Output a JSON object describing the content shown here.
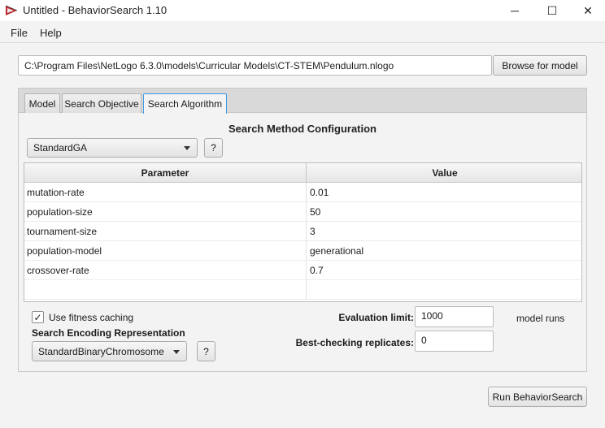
{
  "window": {
    "title": "Untitled - BehaviorSearch 1.10",
    "app_icon": "behaviorsearch-logo-icon",
    "controls": {
      "minimize": "─",
      "maximize": "☐",
      "close": "✕"
    }
  },
  "menu": {
    "items": [
      {
        "label": "File"
      },
      {
        "label": "Help"
      }
    ]
  },
  "model_path": {
    "value": "C:\\Program Files\\NetLogo 6.3.0\\models\\Curricular Models\\CT-STEM\\Pendulum.nlogo",
    "browse_label": "Browse for model"
  },
  "tabs": [
    {
      "label": "Model",
      "active": false
    },
    {
      "label": "Search Objective",
      "active": false
    },
    {
      "label": "Search Algorithm",
      "active": true
    }
  ],
  "search_method": {
    "title": "Search Method Configuration",
    "selected": "StandardGA",
    "help_label": "?"
  },
  "params_table": {
    "headers": {
      "parameter": "Parameter",
      "value": "Value"
    },
    "rows": [
      {
        "parameter": "mutation-rate",
        "value": "0.01"
      },
      {
        "parameter": "population-size",
        "value": "50"
      },
      {
        "parameter": "tournament-size",
        "value": "3"
      },
      {
        "parameter": "population-model",
        "value": "generational"
      },
      {
        "parameter": "crossover-rate",
        "value": "0.7"
      }
    ]
  },
  "fitness_caching": {
    "label": "Use fitness caching",
    "checked": true,
    "check_glyph": "✓"
  },
  "encoding": {
    "title": "Search Encoding Representation",
    "selected": "StandardBinaryChromosome",
    "help_label": "?"
  },
  "evaluation": {
    "limit_label": "Evaluation limit:",
    "limit_value": "1000",
    "units": "model runs",
    "replicates_label": "Best-checking replicates:",
    "replicates_value": "0"
  },
  "run_button": {
    "label": "Run BehaviorSearch"
  },
  "colors": {
    "accent": "#3d9ae8",
    "icon_red": "#c0282d"
  }
}
